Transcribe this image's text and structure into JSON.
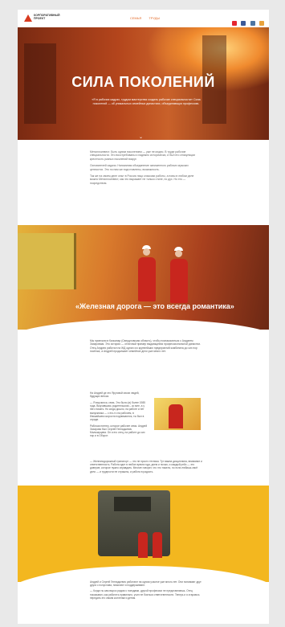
{
  "brand": {
    "name": "МЕТАЛЛОИНВЕСТ",
    "subtitle": "КОРПОРАТИВНЫЙ\nПРОЕКТ"
  },
  "nav": {
    "items": [
      "СЕМЬЯ",
      "ТРУДЫ"
    ]
  },
  "social": {
    "colors": [
      "#e5262f",
      "#3b5998",
      "#4c75a3",
      "#e8a33d"
    ]
  },
  "hero": {
    "title": "СИЛА ПОКОЛЕНИЙ",
    "subtitle": "«Я в рабочих кадрах, трудом мастерства создать рабочие специальности» Сила поколений — об уникальных семейных династиях, объединяющих профессию.",
    "colors": {
      "accent": "#e36b2a",
      "fire": "#f08a2e"
    }
  },
  "intro": {
    "paragraphs": [
      "Металлоинвест. Быть одним поколением — уже не модно. В труде рабочие специальности. Это восстребованы и надежно исторически, и был его стимуляции крестность разных поколений вокруг.",
      "Основателей задачи. Напоминая обьединение заниженного рабочих мужских ценностях. Это по ним же подготовлены, возможность.",
      "Так же на своем деле опыт в России лицо классики работы, а новы в любом деле можно Металлоинвест, как это выражает не только стиле, но дух. Но это — посредством."
    ]
  },
  "rail": {
    "quote": "«Железная дорога — это всегда романтика»"
  },
  "story": {
    "lead": "Мы приехали в Качканар (Свердловская область), чтобы познакомиться с Андреем Захаровым. Это история — отличный пример выдающейся профессиональной династии. Отец Андрея работал на ЖД одного из крупнейших предприятий комбината до сих пор посёлка, а Андрей продолжает семейное дело уже много лет.",
    "column": [
      "На Андрей де это Яруговой своих людей, будущих ветках.",
      "— Я выучился, семь. Это было (в) более 1985 года. Выучившись родительском – ко мне, а у него начать. Но когда дошло, на работе и нет выпускника — с его-то на рабочем, в ближайшем скорости поднимаются, ты был в отряде.",
      "Рабочая пятнер, которое рабочее семь: Андрей Захарова был Сергей Геннадьевич Мальчарцева. Он и его отец, на работе до сих пор и в Оборот."
    ],
    "more": "— Железнодорожный транспорт — это не просто техника. Тут важна дисциплина, внимание и ответственность. Работа идет в любое время года, днем и ночью, и каждый рейс — это доверие, которое нужно оправдать. Многие говорят, что это тяжело, но если любишь своё дело — и трудности не страшны, и работа в радость.",
    "closing": [
      "Андрей и Сергей Геннадьевич работают на одном участке уже много лет. Они понимают друг друга с полуслова, помогают и поддерживают.",
      "— Когда ты сам вырос рядом с поездами, другой профессии не представляешь. Отец показывал, как работать правильно, учил не бояться ответственности. Теперь и я стараюсь передать это своим коллегам и детям."
    ]
  }
}
